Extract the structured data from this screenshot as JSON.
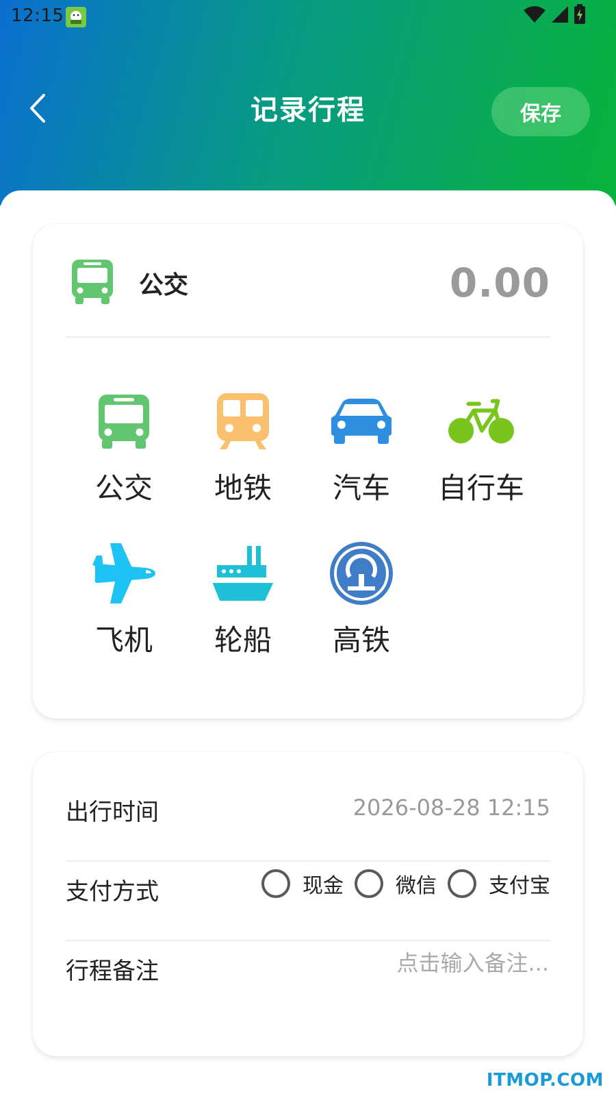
{
  "status_bar": {
    "time": "12:15"
  },
  "header": {
    "title": "记录行程",
    "save_label": "保存"
  },
  "selected": {
    "label": "公交",
    "amount": "0.00"
  },
  "transport_modes": [
    {
      "label": "公交",
      "icon": "bus-icon",
      "color": "#62c670"
    },
    {
      "label": "地铁",
      "icon": "subway-icon",
      "color": "#f9c06e"
    },
    {
      "label": "汽车",
      "icon": "car-icon",
      "color": "#2e8fe0"
    },
    {
      "label": "自行车",
      "icon": "bicycle-icon",
      "color": "#7ac51d"
    },
    {
      "label": "飞机",
      "icon": "airplane-icon",
      "color": "#1cc3f3"
    },
    {
      "label": "轮船",
      "icon": "ship-icon",
      "color": "#1ec0d8"
    },
    {
      "label": "高铁",
      "icon": "high-speed-rail-icon",
      "color": "#3f7ec6"
    }
  ],
  "details": {
    "time_label": "出行时间",
    "time_value": "2026-08-28 12:15",
    "payment_label": "支付方式",
    "payment_options": [
      "现金",
      "微信",
      "支付宝"
    ],
    "note_label": "行程备注",
    "note_placeholder": "点击输入备注..."
  },
  "watermark": "ITMOP.COM"
}
